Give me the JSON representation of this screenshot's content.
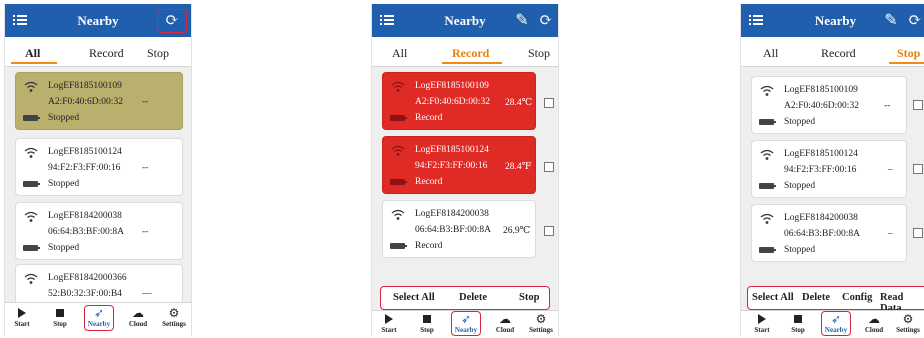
{
  "screens": [
    {
      "title": "Nearby",
      "tabs": [
        "All",
        "Record",
        "Stop"
      ],
      "devices": [
        {
          "name": "LogEF8185100109",
          "mac": "A2:F0:40:6D:00:32",
          "value": "--",
          "status": "Stopped"
        },
        {
          "name": "LogEF8185100124",
          "mac": "94:F2:F3:FF:00:16",
          "value": "--",
          "status": "Stopped"
        },
        {
          "name": "LogEF8184200038",
          "mac": "06:64:B3:BF:00:8A",
          "value": "--",
          "status": "Stopped"
        },
        {
          "name": "LogEF81842000366",
          "mac": "52:B0:32:3F:00:B4",
          "value": "—",
          "status": ""
        }
      ],
      "nav": [
        "Start",
        "Stop",
        "Nearby",
        "Cloud",
        "Settings"
      ]
    },
    {
      "title": "Nearby",
      "tabs": [
        "All",
        "Record",
        "Stop"
      ],
      "devices": [
        {
          "name": "LogEF8185100109",
          "mac": "A2:F0:40:6D:00:32",
          "value": "28.4℃",
          "status": "Record"
        },
        {
          "name": "LogEF8185100124",
          "mac": "94:F2:F3:FF:00:16",
          "value": "28.4℉",
          "status": "Record"
        },
        {
          "name": "LogEF8184200038",
          "mac": "06:64:B3:BF:00:8A",
          "value": "26.9℃",
          "status": "Record"
        }
      ],
      "actions": [
        "Select All",
        "Delete",
        "Stop"
      ],
      "nav": [
        "Start",
        "Stop",
        "Nearby",
        "Cloud",
        "Settings"
      ]
    },
    {
      "title": "Nearby",
      "tabs": [
        "All",
        "Record",
        "Stop"
      ],
      "devices": [
        {
          "name": "LogEF8185100109",
          "mac": "A2:F0:40:6D:00:32",
          "value": "--",
          "status": "Stopped"
        },
        {
          "name": "LogEF8185100124",
          "mac": "94:F2:F3:FF:00:16",
          "value": "–",
          "status": "Stopped"
        },
        {
          "name": "LogEF8184200038",
          "mac": "06:64:B3:BF:00:8A",
          "value": "–",
          "status": "Stopped"
        }
      ],
      "actions": [
        "Select All",
        "Delete",
        "Config",
        "Read Data"
      ],
      "nav": [
        "Start",
        "Stop",
        "Nearby",
        "Cloud",
        "Settings"
      ]
    }
  ],
  "icons": {
    "menu": "menu-icon",
    "refresh": "refresh-icon",
    "edit": "edit-icon",
    "wifi": "wifi-icon",
    "battery": "battery-icon",
    "start": "play-icon",
    "stop": "stop-icon",
    "nearby": "compass-icon",
    "cloud": "cloud-icon",
    "settings": "gear-icon"
  },
  "colors": {
    "header": "#1f5fae",
    "accent_orange": "#f08a1a",
    "highlight": "#d7263d",
    "stopped_card": "#b9b06e",
    "record_card": "#e02a25"
  }
}
